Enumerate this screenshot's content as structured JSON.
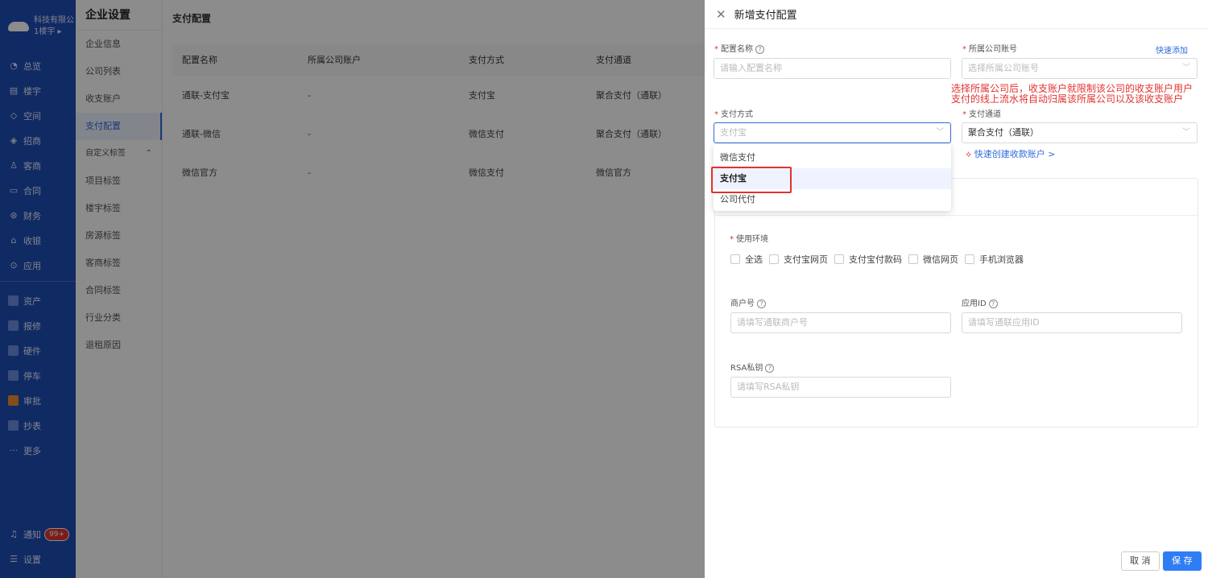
{
  "nav": {
    "company": "科技有限公",
    "building": "1楼宇",
    "items": [
      {
        "label": "总览",
        "icon": "dashboard-icon"
      },
      {
        "label": "楼宇",
        "icon": "building-icon"
      },
      {
        "label": "空间",
        "icon": "cube-icon"
      },
      {
        "label": "招商",
        "icon": "tag-icon"
      },
      {
        "label": "客商",
        "icon": "users-icon"
      },
      {
        "label": "合同",
        "icon": "document-icon"
      },
      {
        "label": "财务",
        "icon": "finance-icon"
      },
      {
        "label": "收银",
        "icon": "home-icon"
      },
      {
        "label": "应用",
        "icon": "app-icon"
      }
    ],
    "items2": [
      "资产",
      "报修",
      "硬件",
      "停车",
      "审批",
      "抄表"
    ],
    "more": "更多",
    "notify": "通知",
    "notify_badge": "99+",
    "settings": "设置"
  },
  "sub": {
    "title": "企业设置",
    "items": [
      "企业信息",
      "公司列表",
      "收支账户",
      "支付配置"
    ],
    "group": "自定义标签",
    "tags": [
      "项目标签",
      "楼宇标签",
      "房源标签",
      "客商标签",
      "合同标签",
      "行业分类",
      "退租原因"
    ]
  },
  "main": {
    "title": "支付配置",
    "columns": [
      "配置名称",
      "所属公司账户",
      "支付方式",
      "支付通道"
    ],
    "rows": [
      [
        "通联-支付宝",
        "-",
        "支付宝",
        "聚合支付（通联）"
      ],
      [
        "通联-微信",
        "-",
        "微信支付",
        "聚合支付（通联）"
      ],
      [
        "微信官方",
        "-",
        "微信支付",
        "微信官方"
      ]
    ]
  },
  "drawer": {
    "title": "新增支付配置",
    "config_name_label": "配置名称",
    "config_name_placeholder": "请输入配置名称",
    "company_label": "所属公司账号",
    "quick_add": "快速添加",
    "company_placeholder": "选择所属公司账号",
    "warning_line1": "选择所属公司后，收支账户就限制该公司的收支账户用户",
    "warning_line2": "支付的线上流水将自动归属该所属公司以及该收支账户",
    "pay_method_label": "支付方式",
    "pay_method_value": "支付宝",
    "channel_label": "支付通道",
    "channel_value": "聚合支付（通联）",
    "quick_create": "快速创建收款账户 >",
    "options": [
      "微信支付",
      "支付宝",
      "公司代付"
    ],
    "env_label": "使用环境",
    "env_options": [
      "全选",
      "支付宝网页",
      "支付宝付款码",
      "微信网页",
      "手机浏览器"
    ],
    "merchant_label": "商户号",
    "merchant_placeholder": "请填写通联商户号",
    "appid_label": "应用ID",
    "appid_placeholder": "请填写通联应用ID",
    "rsa_label": "RSA私钥",
    "rsa_placeholder": "请填写RSA私钥",
    "cancel": "取 消",
    "save": "保 存"
  }
}
